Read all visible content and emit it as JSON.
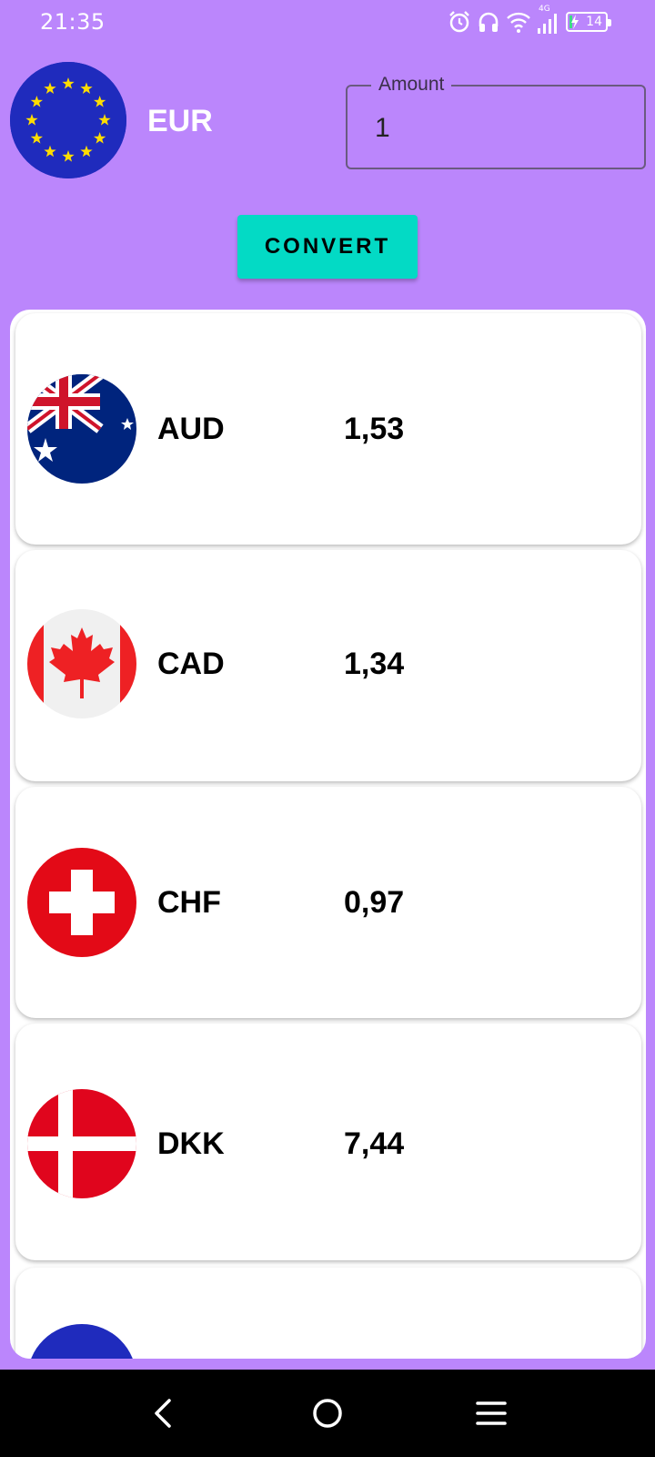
{
  "status_bar": {
    "time": "21:35",
    "network_label": "4G",
    "battery_level": "14"
  },
  "base_currency": {
    "code": "EUR",
    "flag_icon": "eu-flag-icon"
  },
  "amount_field": {
    "label": "Amount",
    "value": "1"
  },
  "convert_button": {
    "label": "CONVERT"
  },
  "rates": [
    {
      "code": "AUD",
      "rate": "1,53",
      "flag_icon": "australia-flag-icon"
    },
    {
      "code": "CAD",
      "rate": "1,34",
      "flag_icon": "canada-flag-icon"
    },
    {
      "code": "CHF",
      "rate": "0,97",
      "flag_icon": "switzerland-flag-icon"
    },
    {
      "code": "DKK",
      "rate": "7,44",
      "flag_icon": "denmark-flag-icon"
    }
  ],
  "colors": {
    "background": "#bb86fc",
    "accent": "#03dac5",
    "card": "#ffffff"
  },
  "nav": {
    "back_icon": "back-icon",
    "home_icon": "home-icon",
    "menu_icon": "menu-icon"
  }
}
